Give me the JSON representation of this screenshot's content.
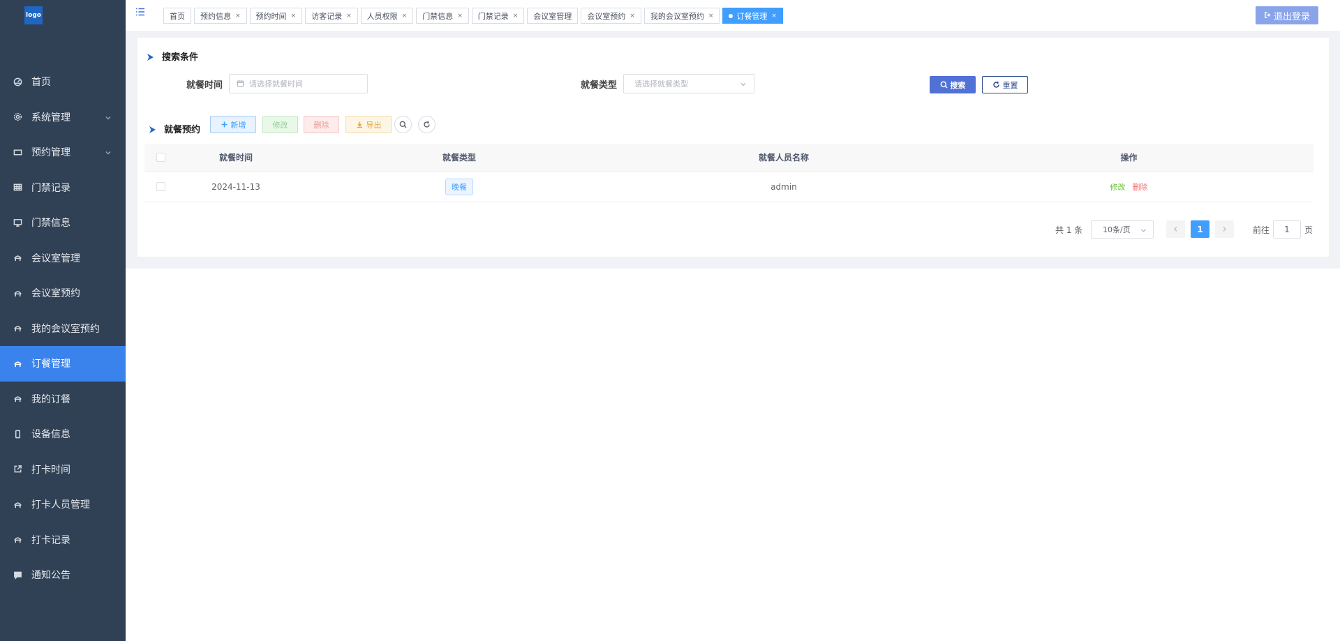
{
  "logo": "logo",
  "sidebar": {
    "items": [
      {
        "label": "首页",
        "icon": "dashboard-icon"
      },
      {
        "label": "系统管理",
        "icon": "gear-icon",
        "expandable": true
      },
      {
        "label": "预约管理",
        "icon": "card-icon",
        "expandable": true
      },
      {
        "label": "门禁记录",
        "icon": "table-icon"
      },
      {
        "label": "门禁信息",
        "icon": "monitor-icon"
      },
      {
        "label": "会议室管理",
        "icon": "meeting-icon"
      },
      {
        "label": "会议室预约",
        "icon": "meeting-icon"
      },
      {
        "label": "我的会议室预约",
        "icon": "meeting-icon"
      },
      {
        "label": "订餐管理",
        "icon": "meeting-icon",
        "active": true
      },
      {
        "label": "我的订餐",
        "icon": "meeting-icon"
      },
      {
        "label": "设备信息",
        "icon": "phone-icon"
      },
      {
        "label": "打卡时间",
        "icon": "external-link-icon"
      },
      {
        "label": "打卡人员管理",
        "icon": "meeting-icon"
      },
      {
        "label": "打卡记录",
        "icon": "meeting-icon"
      },
      {
        "label": "通知公告",
        "icon": "message-icon"
      }
    ]
  },
  "tags": [
    {
      "label": "首页",
      "closable": false
    },
    {
      "label": "预约信息",
      "closable": true
    },
    {
      "label": "预约时间",
      "closable": true
    },
    {
      "label": "访客记录",
      "closable": true
    },
    {
      "label": "人员权限",
      "closable": true
    },
    {
      "label": "门禁信息",
      "closable": true
    },
    {
      "label": "门禁记录",
      "closable": true
    },
    {
      "label": "会议室管理",
      "closable": false
    },
    {
      "label": "会议室预约",
      "closable": true
    },
    {
      "label": "我的会议室预约",
      "closable": true
    },
    {
      "label": "订餐管理",
      "closable": true,
      "active": true
    }
  ],
  "tag_close": "×",
  "logout_label": "退出登录",
  "search": {
    "title": "搜索条件",
    "time_label": "就餐时间",
    "time_placeholder": "请选择就餐时间",
    "type_label": "就餐类型",
    "type_placeholder": "请选择就餐类型",
    "search_btn": "搜索",
    "reset_btn": "重置"
  },
  "list": {
    "title": "就餐预约",
    "add_btn": "新增",
    "edit_btn": "修改",
    "delete_btn": "删除",
    "export_btn": "导出"
  },
  "table": {
    "headers": {
      "time": "就餐时间",
      "type": "就餐类型",
      "name": "就餐人员名称",
      "op": "操作"
    },
    "rows": [
      {
        "time": "2024-11-13",
        "type": "晚餐",
        "name": "admin",
        "edit": "修改",
        "del": "删除"
      }
    ]
  },
  "pagination": {
    "total": "共 1 条",
    "page_size": "10条/页",
    "current": "1",
    "goto_prefix": "前往",
    "goto_value": "1",
    "goto_suffix": "页"
  },
  "colors": {
    "sidebar_bg": "#304156",
    "active": "#3a82ec",
    "primary": "#409eff"
  }
}
